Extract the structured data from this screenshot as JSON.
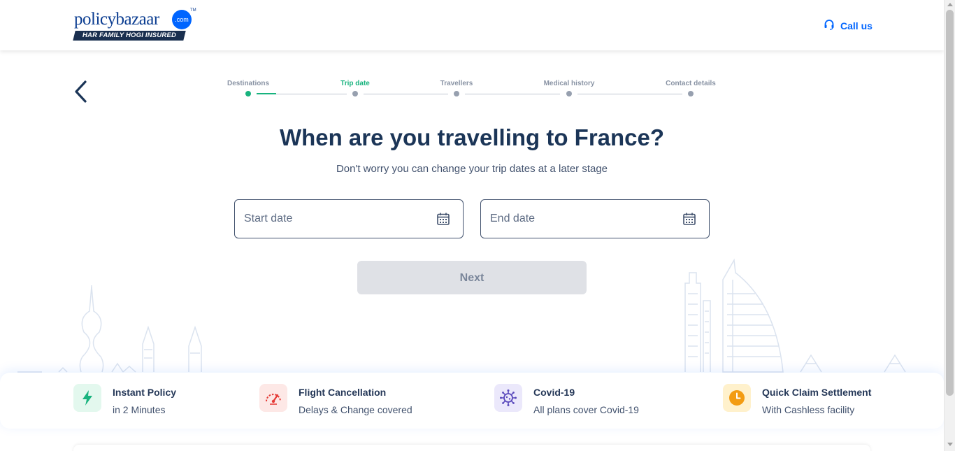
{
  "header": {
    "logo_word": "policybazaar",
    "logo_com": ".com",
    "logo_tagline": "HAR FAMILY HOGI INSURED",
    "call_label": "Call us"
  },
  "stepper": {
    "steps": [
      {
        "label": "Destinations",
        "state": "done"
      },
      {
        "label": "Trip date",
        "state": "active"
      },
      {
        "label": "Travellers",
        "state": "pending"
      },
      {
        "label": "Medical history",
        "state": "pending"
      },
      {
        "label": "Contact details",
        "state": "pending"
      }
    ]
  },
  "main": {
    "title": "When are you travelling to France?",
    "subtitle": "Don't worry you can change your trip dates at a later stage",
    "start_date_placeholder": "Start date",
    "end_date_placeholder": "End date",
    "next_label": "Next"
  },
  "features": [
    {
      "title": "Instant Policy",
      "subtitle": "in 2 Minutes",
      "icon": "lightning-icon",
      "color": "#18b37e",
      "bg": "#e3f8ee"
    },
    {
      "title": "Flight Cancellation",
      "subtitle": "Delays & Change covered",
      "icon": "flight-gauge-icon",
      "color": "#e53935",
      "bg": "#fde8e6"
    },
    {
      "title": "Covid-19",
      "subtitle": "All plans cover Covid-19",
      "icon": "virus-icon",
      "color": "#5b4bbd",
      "bg": "#ebe8fb"
    },
    {
      "title": "Quick Claim Settlement",
      "subtitle": "With Cashless facility",
      "icon": "clock-icon",
      "color": "#f39c12",
      "bg": "#fff1cc"
    }
  ],
  "colors": {
    "brand_blue": "#0065ff",
    "heading": "#1b3557",
    "active_green": "#18b37e",
    "button_disabled_bg": "#dfe1e6"
  }
}
